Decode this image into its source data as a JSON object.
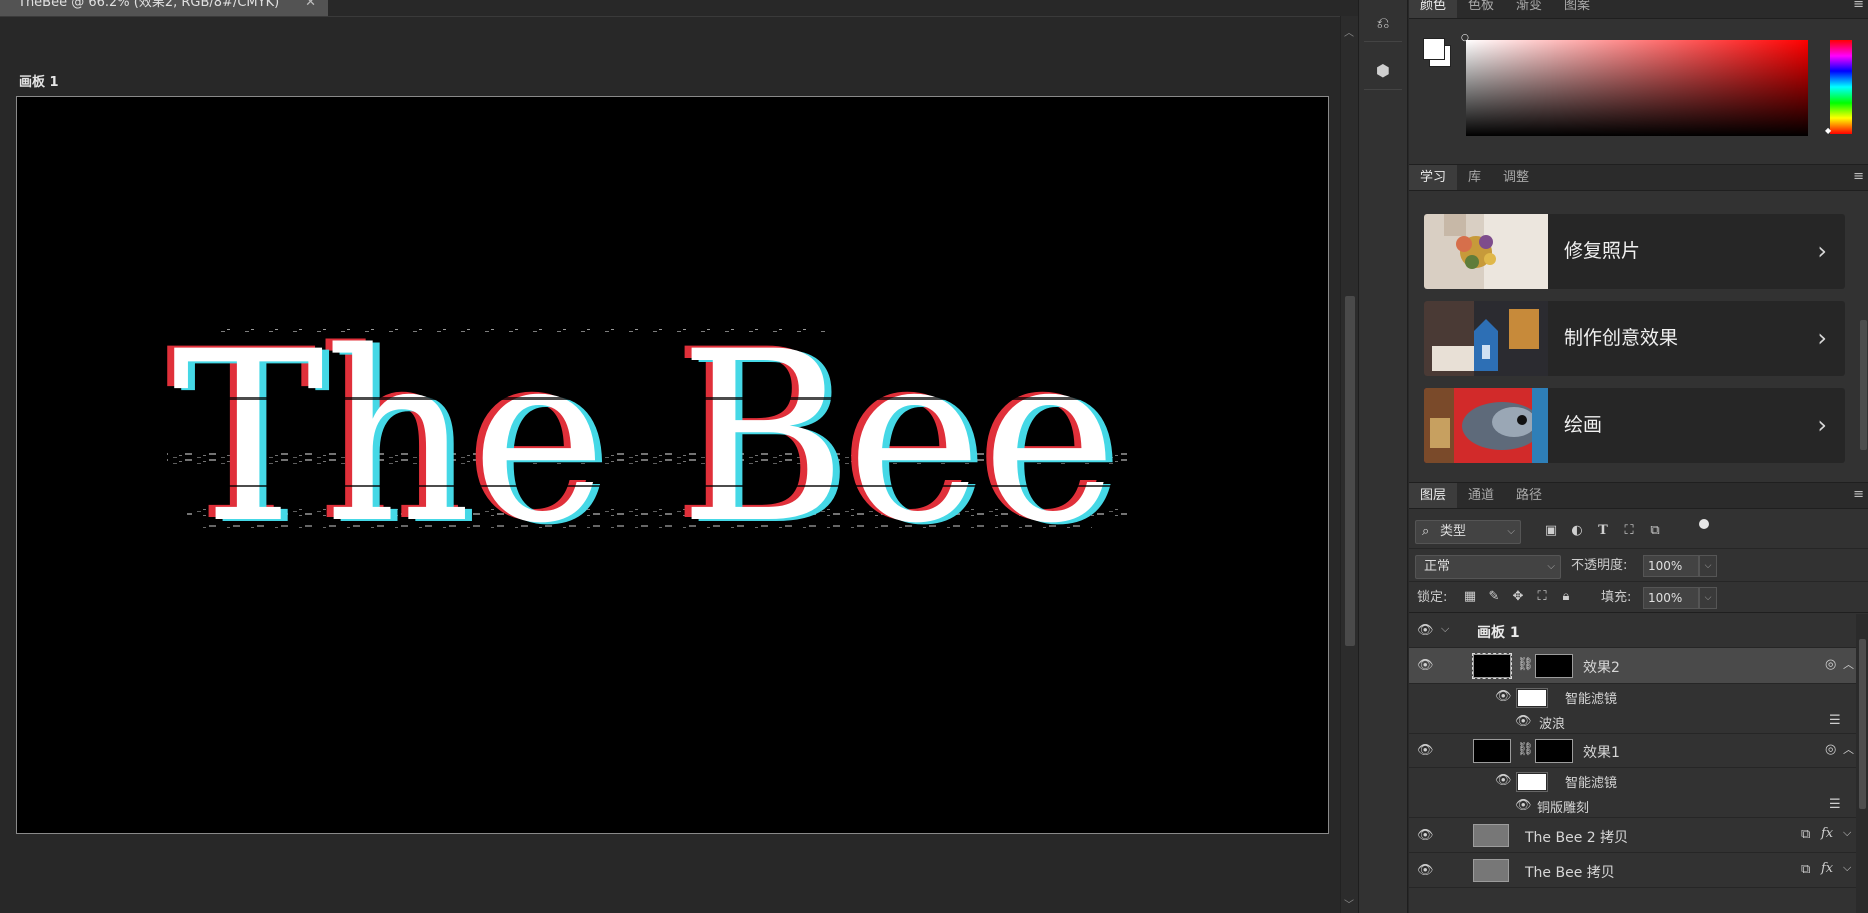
{
  "document": {
    "tab_title": "TheBee @ 66.2% (效果2, RGB/8#/CMYK)",
    "artboard_label": "画板 1",
    "canvas_text": "The Bee"
  },
  "color_panel": {
    "tabs": [
      "颜色",
      "色板",
      "渐变",
      "图案"
    ],
    "foreground_color": "#ffffff",
    "background_color": "#ffffff",
    "hue_color": "#ff0000"
  },
  "learn_panel": {
    "tabs": [
      "学习",
      "库",
      "调整"
    ],
    "cards": [
      {
        "label": "修复照片"
      },
      {
        "label": "制作创意效果"
      },
      {
        "label": "绘画"
      }
    ]
  },
  "layers_panel": {
    "tabs": [
      "图层",
      "通道",
      "路径"
    ],
    "filter_label": "类型",
    "blend_mode": "正常",
    "opacity_label": "不透明度:",
    "opacity_value": "100%",
    "lock_label": "锁定:",
    "fill_label": "填充:",
    "fill_value": "100%",
    "layers": [
      {
        "name": "画板 1",
        "kind": "artboard"
      },
      {
        "name": "效果2",
        "kind": "smart-object",
        "selected": true
      },
      {
        "name": "智能滤镜",
        "kind": "filter-group"
      },
      {
        "name": "波浪",
        "kind": "filter"
      },
      {
        "name": "效果1",
        "kind": "smart-object"
      },
      {
        "name": "智能滤镜",
        "kind": "filter-group"
      },
      {
        "name": "铜版雕刻",
        "kind": "filter"
      },
      {
        "name": "The Bee 2 拷贝",
        "kind": "smart-object-fx"
      },
      {
        "name": "The Bee 拷贝",
        "kind": "smart-object-fx"
      }
    ]
  }
}
